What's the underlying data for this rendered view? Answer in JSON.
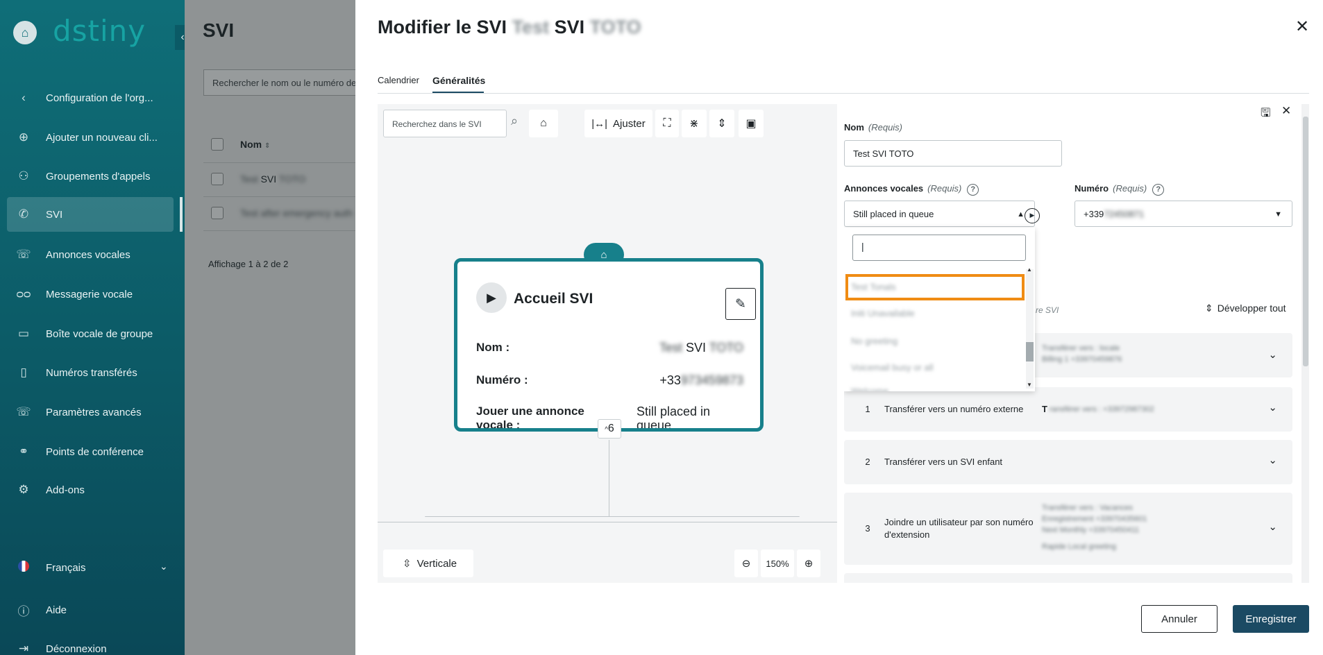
{
  "sidebar": {
    "brand": "dstiny",
    "collapse_icon": "‹",
    "items": [
      {
        "label": "Configuration de l'org...",
        "icon": "chevron-left-icon"
      },
      {
        "label": "Ajouter un nouveau cli...",
        "icon": "plus-circle-icon"
      },
      {
        "label": "Groupements d'appels",
        "icon": "call-group-icon"
      },
      {
        "label": "SVI",
        "icon": "ivr-phone-icon"
      },
      {
        "label": "Annonces vocales",
        "icon": "voice-announcement-icon"
      },
      {
        "label": "Messagerie vocale",
        "icon": "voicemail-icon"
      },
      {
        "label": "Boîte vocale de groupe",
        "icon": "group-voicemail-icon"
      },
      {
        "label": "Numéros transférés",
        "icon": "transferred-numbers-icon"
      },
      {
        "label": "Paramètres avancés",
        "icon": "advanced-settings-icon"
      },
      {
        "label": "Points de conférence",
        "icon": "conference-icon"
      },
      {
        "label": "Add-ons",
        "icon": "addons-icon"
      }
    ],
    "language": "Français",
    "help": "Aide",
    "logout": "Déconnexion"
  },
  "background_page": {
    "title": "SVI",
    "search_placeholder": "Rechercher le nom ou le numéro de té",
    "column_name": "Nom",
    "rows": [
      {
        "blur_prefix": "Test",
        "text": "SVI",
        "blur_suffix": "TOTO"
      },
      {
        "blur_text": "Test after emergency auth"
      }
    ],
    "count_text": "Affichage 1 à 2 de 2"
  },
  "modal": {
    "title_prefix": "Modifier le SVI",
    "title_blur_1": "Test",
    "title_middle": "SVI",
    "title_blur_2": "TOTO",
    "close_icon": "✕",
    "tabs": [
      {
        "label": "Calendrier",
        "active": false
      },
      {
        "label": "Généralités",
        "active": true
      }
    ],
    "canvas": {
      "search_placeholder": "Recherchez dans le SVI",
      "adjust_label": "Ajuster",
      "node": {
        "title": "Accueil SVI",
        "nom_label": "Nom :",
        "nom_blur_1": "Test",
        "nom_value": "SVI",
        "nom_blur_2": "TOTO",
        "numero_label": "Numéro :",
        "numero_prefix": "+33",
        "numero_blur": "973459873",
        "annonce_label_1": "Jouer une annonce",
        "annonce_label_2": "vocale :",
        "annonce_value_1": "Still placed in",
        "annonce_value_2": "queue",
        "children_count": "6"
      },
      "vertical_label": "Verticale",
      "zoom_level": "150%"
    },
    "form": {
      "nom_label": "Nom",
      "required_text": "(Requis)",
      "nom_value": "Test SVI TOTO",
      "annonces_label": "Annonces vocales",
      "annonces_value": "Still placed in queue",
      "numero_label": "Numéro",
      "numero_prefix": "+339",
      "numero_blur": "72450871",
      "dropdown": {
        "search_value": "|",
        "options": [
          "Test Tonals",
          "Initi Unavailable",
          "No greeting",
          "Voicemail busy or all",
          "Welcome"
        ]
      },
      "faded_text": "re SVI",
      "develop_all": "Développer tout",
      "cards": [
        {
          "num": "",
          "text": "",
          "blur_1": "Transférer vers : locale",
          "blur_2": "Billing 1 +33970459876"
        },
        {
          "num": "1",
          "text": "Transférer vers un numéro externe",
          "lead": "T",
          "blur_1": "ransférer vers : +33972987302"
        },
        {
          "num": "2",
          "text": "Transférer vers un SVI enfant"
        },
        {
          "num": "3",
          "text_1": "Joindre un utilisateur par son numéro",
          "text_2": "d'extension",
          "blur_1": "Transférer vers : Vacances",
          "blur_2": "Enregistrement +33970435601",
          "blur_3": "Next Monthly +33970450411",
          "blur_4": "Rapide  Local greeting"
        }
      ]
    },
    "cancel_label": "Annuler",
    "save_label": "Enregistrer"
  }
}
